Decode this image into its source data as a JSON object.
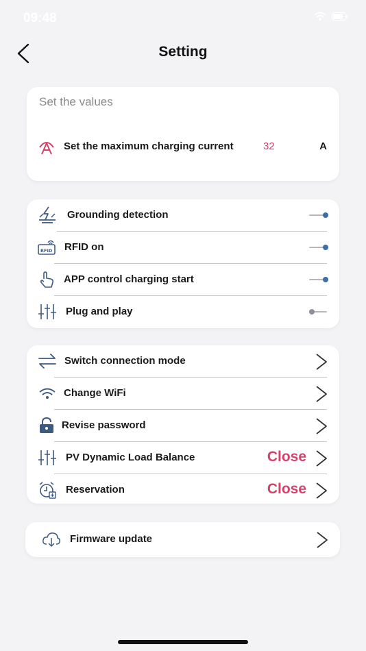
{
  "status_bar": {
    "time": "09:48"
  },
  "header": {
    "title": "Setting"
  },
  "values_card": {
    "section_title": "Set the values",
    "max_current_label": "Set the maximum charging current",
    "max_current_value": "32",
    "max_current_unit": "A"
  },
  "toggles": [
    {
      "label": "Grounding detection",
      "state": "on"
    },
    {
      "label": "RFID on",
      "state": "on"
    },
    {
      "label": "APP control charging start",
      "state": "on"
    },
    {
      "label": "Plug and play",
      "state": "off"
    }
  ],
  "nav_items": [
    {
      "label": "Switch connection mode",
      "status": ""
    },
    {
      "label": "Change WiFi",
      "status": ""
    },
    {
      "label": "Revise password",
      "status": ""
    },
    {
      "label": "PV Dynamic Load Balance",
      "status": "Close"
    },
    {
      "label": "Reservation",
      "status": "Close"
    }
  ],
  "firmware": {
    "label": "Firmware update"
  },
  "icons": {
    "back": "chevron-left-icon",
    "current": "current-gauge-icon",
    "grounding": "lightning-ground-icon",
    "rfid": "rfid-icon",
    "app_control": "touch-hand-icon",
    "plug_play": "sliders-icon",
    "switch_mode": "swap-arrows-icon",
    "wifi": "wifi-icon",
    "password": "lock-icon",
    "pv_balance": "sliders-icon",
    "reservation": "alarm-clock-icon",
    "firmware": "cloud-download-icon"
  },
  "colors": {
    "accent": "#d5416a",
    "toggle_on": "#3d6ea8",
    "icon": "#3d5a80",
    "background": "#f3f3f6"
  }
}
